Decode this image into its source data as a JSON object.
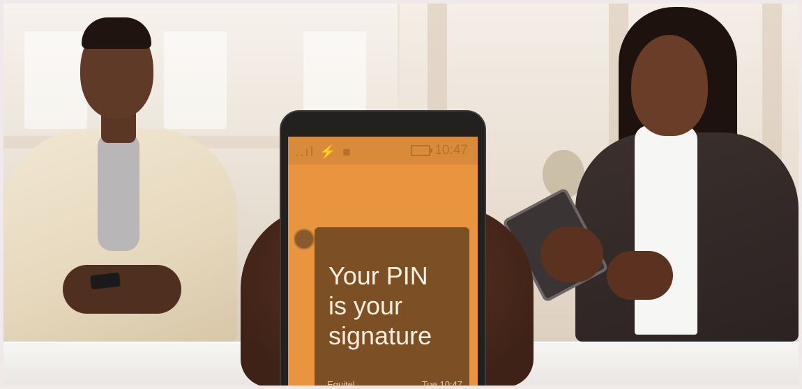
{
  "phone": {
    "status_time": "10:47",
    "status_icons": "..ıl ⚡ ■",
    "message": {
      "line1": "Your PIN",
      "line2": "is your",
      "line3": "signature",
      "sender": "Equitel",
      "timestamp": "Tue 10:47"
    }
  },
  "colors": {
    "screen": "#e9953f",
    "bubble": "#7d4f24",
    "headline_text": "#fdf0e0"
  }
}
